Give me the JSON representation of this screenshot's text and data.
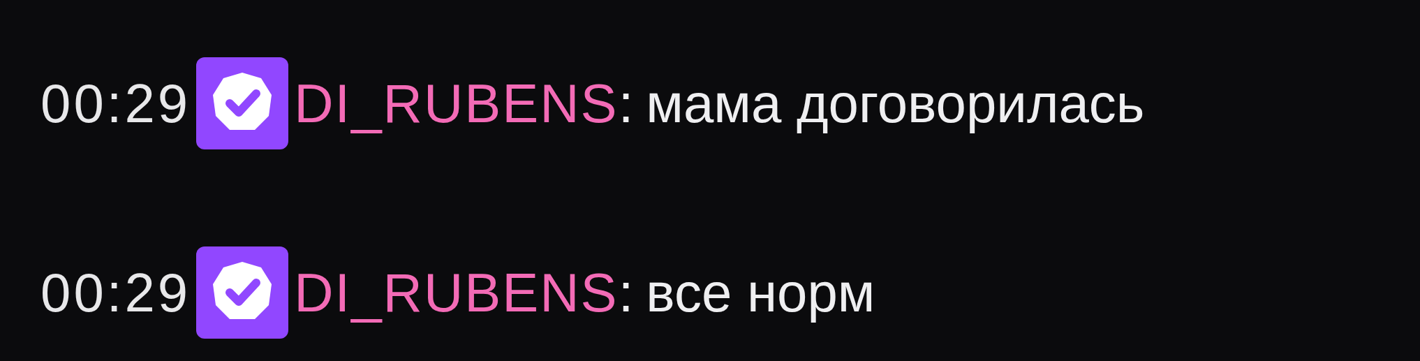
{
  "messages": [
    {
      "time": "00:29",
      "username": "DI_RUBENS",
      "color": "#f36bb6",
      "separator": ":",
      "text": "мама договорилась"
    },
    {
      "time": "00:29",
      "username": "DI_RUBENS",
      "color": "#f36bb6",
      "separator": ":",
      "text": "все норм"
    }
  ]
}
